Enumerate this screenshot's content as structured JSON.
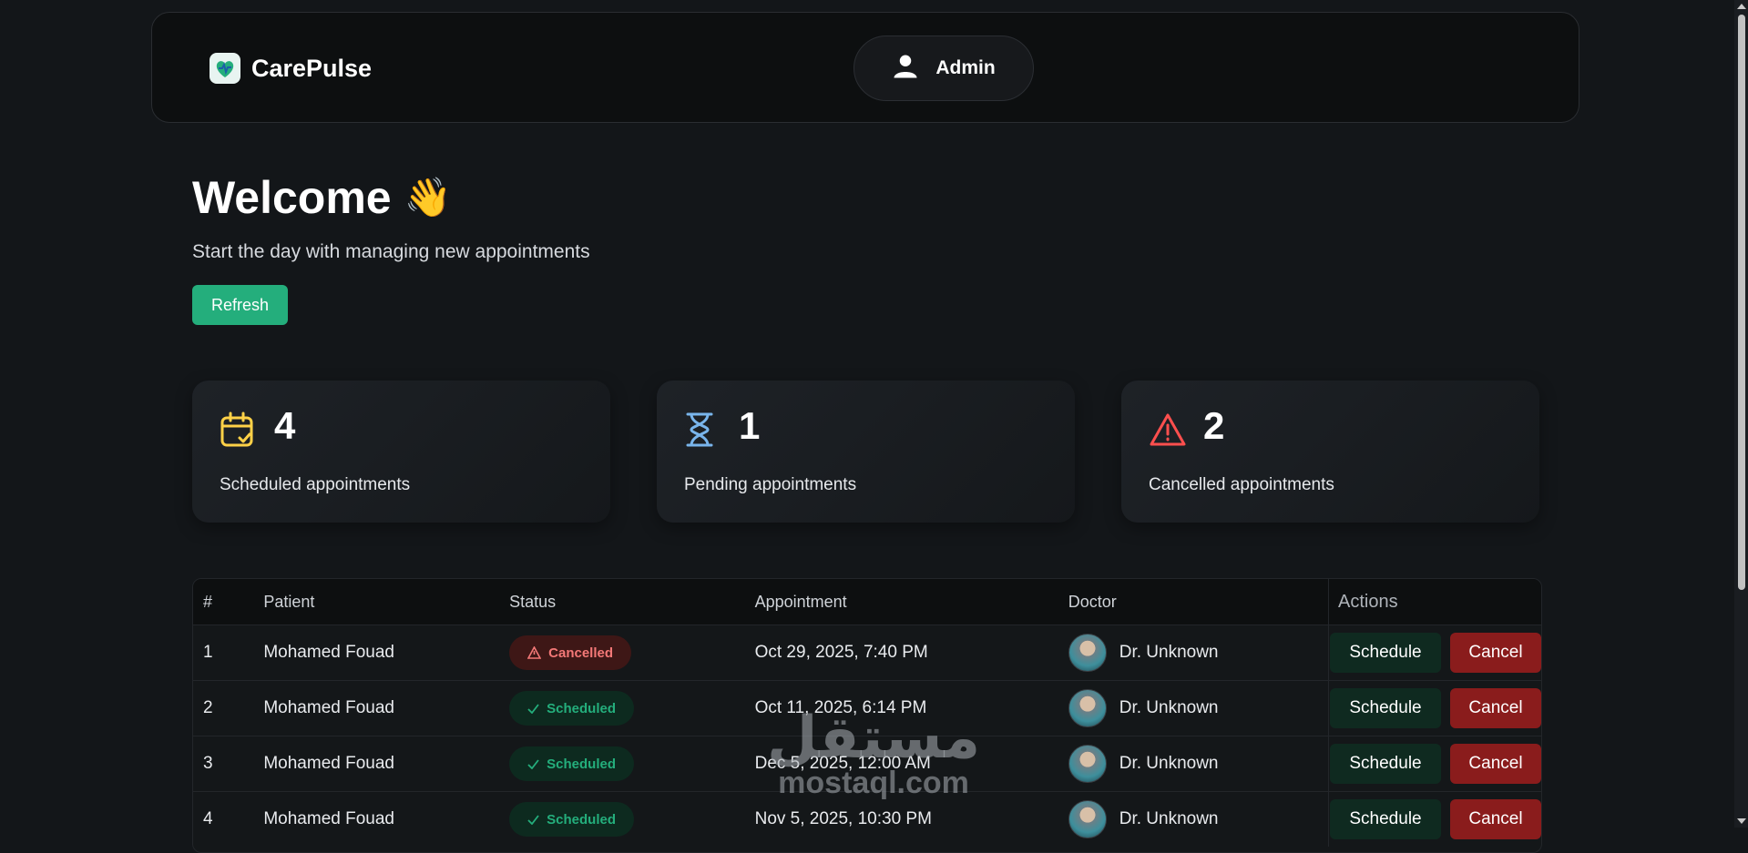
{
  "header": {
    "brand": "CarePulse",
    "user_label": "Admin"
  },
  "welcome": {
    "title": "Welcome",
    "emoji": "👋",
    "subtitle": "Start the day with managing new appointments",
    "refresh_label": "Refresh"
  },
  "stats": [
    {
      "count": "4",
      "label": "Scheduled appointments",
      "icon": "calendar-check-icon",
      "color": "#ffd147"
    },
    {
      "count": "1",
      "label": "Pending appointments",
      "icon": "hourglass-icon",
      "color": "#79b5ec"
    },
    {
      "count": "2",
      "label": "Cancelled appointments",
      "icon": "warning-icon",
      "color": "#ff4f4e"
    }
  ],
  "table": {
    "headers": [
      "#",
      "Patient",
      "Status",
      "Appointment",
      "Doctor",
      "Actions"
    ],
    "rows": [
      {
        "num": "1",
        "patient": "Mohamed Fouad",
        "status": "Cancelled",
        "appointment": "Oct 29, 2025, 7:40 PM",
        "doctor": "Dr. Unknown"
      },
      {
        "num": "2",
        "patient": "Mohamed Fouad",
        "status": "Scheduled",
        "appointment": "Oct 11, 2025, 6:14 PM",
        "doctor": "Dr. Unknown"
      },
      {
        "num": "3",
        "patient": "Mohamed Fouad",
        "status": "Scheduled",
        "appointment": "Dec 5, 2025, 12:00 AM",
        "doctor": "Dr. Unknown"
      },
      {
        "num": "4",
        "patient": "Mohamed Fouad",
        "status": "Scheduled",
        "appointment": "Nov 5, 2025, 10:30 PM",
        "doctor": "Dr. Unknown"
      }
    ],
    "schedule_label": "Schedule",
    "cancel_label": "Cancel"
  },
  "watermark": {
    "arabic": "مستقل",
    "latin": "mostaql.com"
  },
  "colors": {
    "accent_green": "#24ae7c",
    "danger_red": "#8a1c1c",
    "background": "#131619"
  }
}
